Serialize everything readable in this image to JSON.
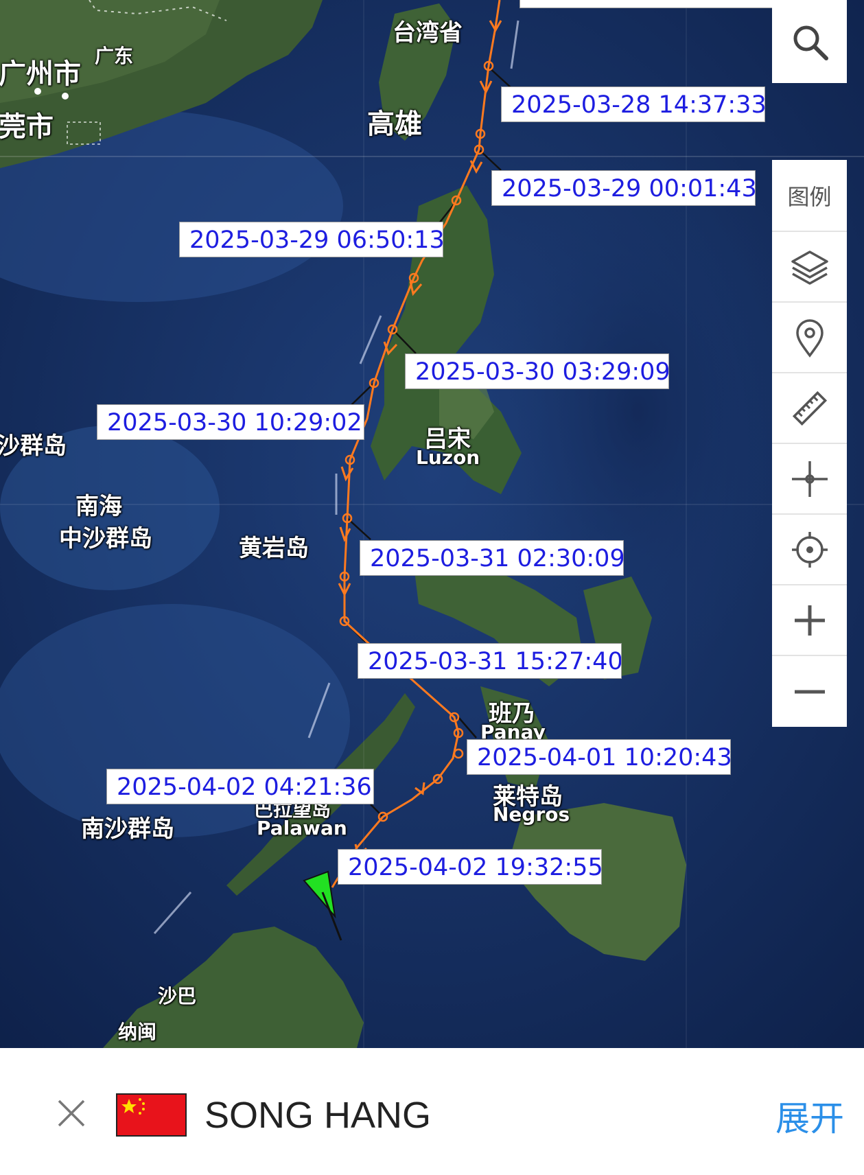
{
  "map": {
    "place_labels": [
      {
        "id": "taiwan",
        "text": "台湾省"
      },
      {
        "id": "guangzhou",
        "text": "广州市"
      },
      {
        "id": "guangdong",
        "text": "广东"
      },
      {
        "id": "dongguan",
        "text": "莞市"
      },
      {
        "id": "kaohsiung",
        "text": "高雄"
      },
      {
        "id": "dongsha",
        "text": "沙群岛"
      },
      {
        "id": "nanhai",
        "text": "南海"
      },
      {
        "id": "zhongsha",
        "text": "中沙群岛"
      },
      {
        "id": "huangyan",
        "text": "黄岩岛"
      },
      {
        "id": "luzon_cn",
        "text": "吕宋"
      },
      {
        "id": "luzon_en",
        "text": "Luzon"
      },
      {
        "id": "panay_cn",
        "text": "班乃"
      },
      {
        "id": "panay_en",
        "text": "Panay"
      },
      {
        "id": "negros_cn",
        "text": "莱特岛"
      },
      {
        "id": "negros_en",
        "text": "Negros"
      },
      {
        "id": "nansha",
        "text": "南沙群岛"
      },
      {
        "id": "palawan_cn",
        "text": "巴拉望岛"
      },
      {
        "id": "palawan_en",
        "text": "Palawan"
      },
      {
        "id": "sabah",
        "text": "沙巴"
      },
      {
        "id": "nadu",
        "text": "纳闽"
      }
    ],
    "track_timestamps": [
      "2025-03-28 14:37:33",
      "2025-03-29 00:01:43",
      "2025-03-29 06:50:13",
      "2025-03-30 03:29:09",
      "2025-03-30 10:29:02",
      "2025-03-31 02:30:09",
      "2025-03-31 15:27:40",
      "2025-04-01 10:20:43",
      "2025-04-02 04:21:36",
      "2025-04-02 19:32:55"
    ],
    "track_color": "#ff7a1f",
    "ship_marker_color": "#22e022"
  },
  "toolbar": {
    "search_icon": "search-icon",
    "legend_label": "图例",
    "tools": [
      "layers-icon",
      "location-pin-icon",
      "ruler-icon",
      "crosshair-icon",
      "locate-target-icon",
      "zoom-in-icon",
      "zoom-out-icon"
    ]
  },
  "bottom_bar": {
    "close_icon": "close-icon",
    "flag": "china-flag",
    "ship_name": "SONG HANG",
    "expand_label": "展开"
  }
}
